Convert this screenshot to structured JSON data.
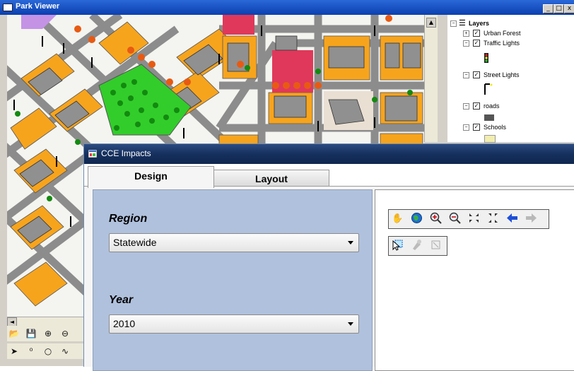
{
  "park_viewer": {
    "title": "Park Viewer",
    "window_controls": {
      "minimize": "_",
      "maximize": "□",
      "close": "x"
    },
    "layers": {
      "root_label": "Layers",
      "items": [
        {
          "label": "Urban Forest",
          "checked": true,
          "expanded": false
        },
        {
          "label": "Traffic Lights",
          "checked": true,
          "expanded": true,
          "legend_icon": "traffic-light-icon"
        },
        {
          "label": "Street Lights",
          "checked": true,
          "expanded": true,
          "legend_icon": "street-light-icon"
        },
        {
          "label": "roads",
          "checked": true,
          "expanded": true,
          "legend_icon": "road-swatch"
        },
        {
          "label": "Schools",
          "checked": true,
          "expanded": true,
          "legend_icon": "school-swatch"
        }
      ]
    },
    "toolbar_row1": [
      "open-folder-icon",
      "save-icon",
      "zoom-in-icon",
      "zoom-out-icon"
    ],
    "toolbar_row2": [
      "select-arrow-icon",
      "node-edit-icon",
      "circle-draw-icon",
      "curve-draw-icon"
    ],
    "map_colors": {
      "background": "#f4f4f0",
      "roads": "#8c8c8c",
      "blocks": "#f7a41d",
      "buildings": "#909090",
      "park": "#32cd2a",
      "schools_purple": "#c493e6",
      "red_zone": "#e0385a",
      "plaza": "#eadfd3"
    }
  },
  "cce": {
    "title": "CCE Impacts",
    "tabs": [
      {
        "label": "Design",
        "active": true
      },
      {
        "label": "Layout",
        "active": false
      }
    ],
    "region_label": "Region",
    "region_value": "Statewide",
    "year_label": "Year",
    "year_value": "2010",
    "map_toolbar_row1": [
      "pan-hand-icon",
      "globe-full-extent-icon",
      "zoom-in-icon",
      "zoom-out-icon",
      "zoom-in-fixed-icon",
      "zoom-out-fixed-icon",
      "back-arrow-icon",
      "forward-arrow-icon"
    ],
    "map_toolbar_row2": [
      "select-features-icon",
      "identify-icon",
      "clear-selection-icon"
    ],
    "colors": {
      "titlebar": "#16305e",
      "design_panel": "#b0c1dd",
      "back_arrow": "#1f4fd8",
      "forward_arrow": "#b8b8b8"
    }
  }
}
